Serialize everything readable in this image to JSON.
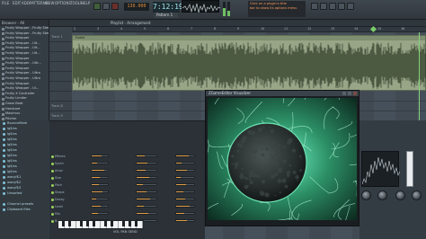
{
  "toolbar": {
    "menu": [
      "FILE",
      "EDIT",
      "ADD",
      "PATTERNS",
      "VIEW",
      "OPTIONS",
      "TOOLS",
      "HELP"
    ],
    "time": "7:12:19",
    "tempo": "130.000",
    "pattern": "Pattern 1",
    "hint_lines": [
      "Click on a plugin's title",
      "bar to show its options menu"
    ]
  },
  "browser": {
    "title": "Browser - All",
    "items": [
      "Fruity Wrapper - Fruity Ster...",
      "Fruity Wrapper - Fruity Ster...",
      "Fruity Wrapper",
      "Fruity Wrapper - Ult...",
      "Fruity Wrapper - Ult...",
      "Fruity Wrapper - Ult...",
      "Fruity Wrapper",
      "Fruity Wrapper - Ultr...",
      "Fruity Wrapper",
      "Fruity Wrapper - Ultra",
      "Fruity Wrapper - Ultra",
      "Fruity Wrapper",
      "Fruity Wrapper - Ul...",
      "Fruity X Controller",
      "Fruity Limiter",
      "Gross Beat",
      "Hardcore",
      "Maximus",
      "Pitcher",
      "NTB Pro Wrapper",
      "Soundgoodizer",
      "Wave Candy",
      "ZGameEditor Visualizer"
    ],
    "channels": [
      "BounceMark",
      "lg$ins",
      "lg$ins",
      "lg$ins",
      "lg$ins",
      "lg$ins",
      "lg$ins",
      "lg$ins",
      "lg$ins",
      "lg$ins",
      "wavyf$1",
      "wavyf$2",
      "wavyf$3",
      "Unsorted"
    ],
    "bottom_items": [
      "Channel presets",
      "Clipboard files"
    ]
  },
  "playlist": {
    "title": "Playlist - Arrangement",
    "ruler": [
      "2",
      "3",
      "4",
      "5",
      "6",
      "7",
      "8",
      "9",
      "10",
      "11",
      "12",
      "13",
      "14",
      "15",
      "16"
    ],
    "track_labels": [
      "Track 1",
      "",
      "",
      "",
      "",
      "",
      "",
      "Track 8",
      "Track 9",
      "Track 10"
    ],
    "clip_name": "Faded"
  },
  "plugin": {
    "title": "ZGameEditor Visualizer"
  },
  "channel_rack": {
    "rows": [
      {
        "label": "Effects"
      },
      {
        "label": "Synth"
      },
      {
        "label": "Ampl"
      },
      {
        "label": "Size"
      },
      {
        "label": "Pitch"
      },
      {
        "label": "Shape"
      },
      {
        "label": "Decay"
      },
      {
        "label": "Level"
      },
      {
        "label": "Mix"
      },
      {
        "label": "Rate"
      }
    ]
  },
  "keyboard": {
    "label": "VOL  PAN  SEND"
  },
  "colors": {
    "clip": "#98a587",
    "accent_green": "#86d27a",
    "accent_orange": "#e19d47",
    "viz_green": "#3fd39a"
  }
}
